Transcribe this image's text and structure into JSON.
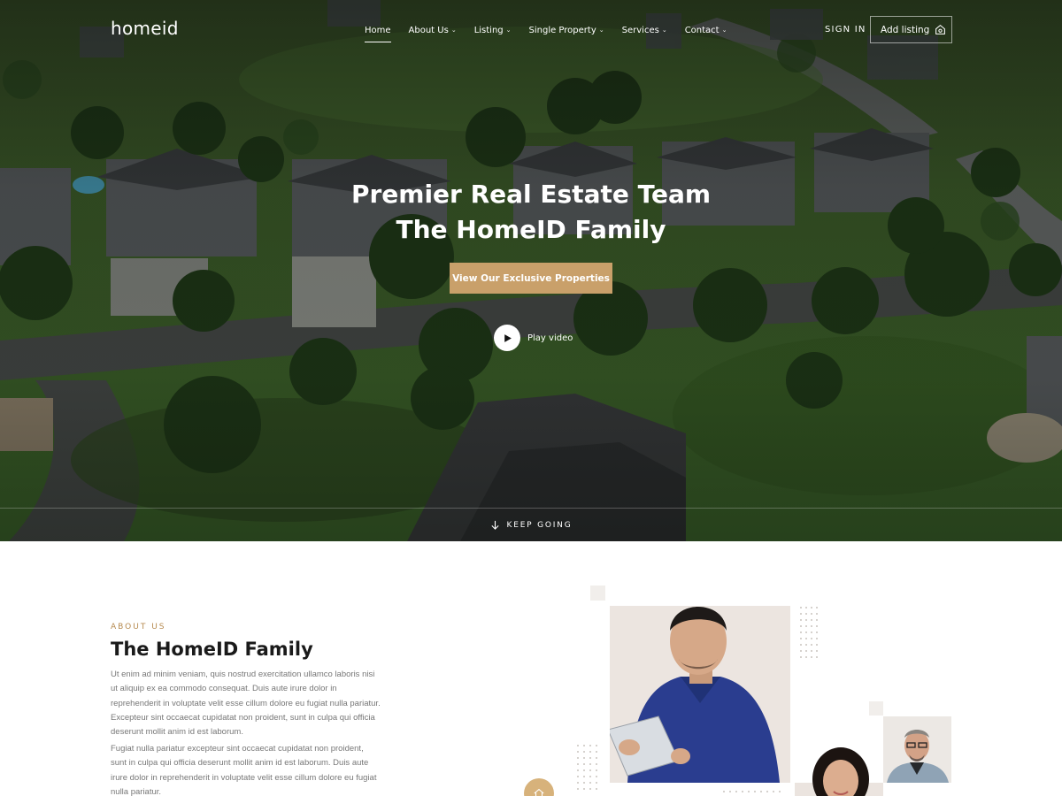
{
  "brand": {
    "logo_text": "homeid"
  },
  "nav": {
    "items": [
      {
        "label": "Home",
        "dropdown": false,
        "active": true
      },
      {
        "label": "About Us",
        "dropdown": true,
        "active": false
      },
      {
        "label": "Listing",
        "dropdown": true,
        "active": false
      },
      {
        "label": "Single Property",
        "dropdown": true,
        "active": false
      },
      {
        "label": "Services",
        "dropdown": true,
        "active": false
      },
      {
        "label": "Contact",
        "dropdown": true,
        "active": false
      }
    ],
    "sign_in": "SIGN IN",
    "add_listing": "Add listing"
  },
  "hero": {
    "title_line1": "Premier Real Estate Team",
    "title_line2": "The HomeID Family",
    "cta_label": "View Our Exclusive Properties",
    "play_label": "Play video",
    "keep_going": "KEEP GOING"
  },
  "about": {
    "kicker": "ABOUT US",
    "title": "The HomeID Family",
    "paragraph1": "Ut enim ad minim veniam, quis nostrud exercitation ullamco laboris nisi ut aliquip ex ea commodo consequat. Duis aute irure dolor in reprehenderit in voluptate velit esse cillum dolore eu fugiat nulla pariatur. Excepteur sint occaecat cupidatat non proident, sunt in culpa qui officia deserunt mollit anim id est laborum.",
    "paragraph2": "Fugiat nulla pariatur excepteur sint occaecat cupidatat non proident, sunt in culpa qui officia deserunt mollit anim id est laborum. Duis aute irure dolor in reprehenderit in voluptate velit esse cillum dolore eu fugiat nulla pariatur."
  },
  "colors": {
    "accent": "#c9a06a",
    "kicker": "#b68a4f",
    "hero_overlay": "#0a0e0a"
  },
  "icons": {
    "nav_dropdown": "chevron-down-icon",
    "add_listing": "house-icon",
    "play": "play-icon",
    "keep_going": "arrow-down-icon",
    "badge": "house-icon"
  }
}
